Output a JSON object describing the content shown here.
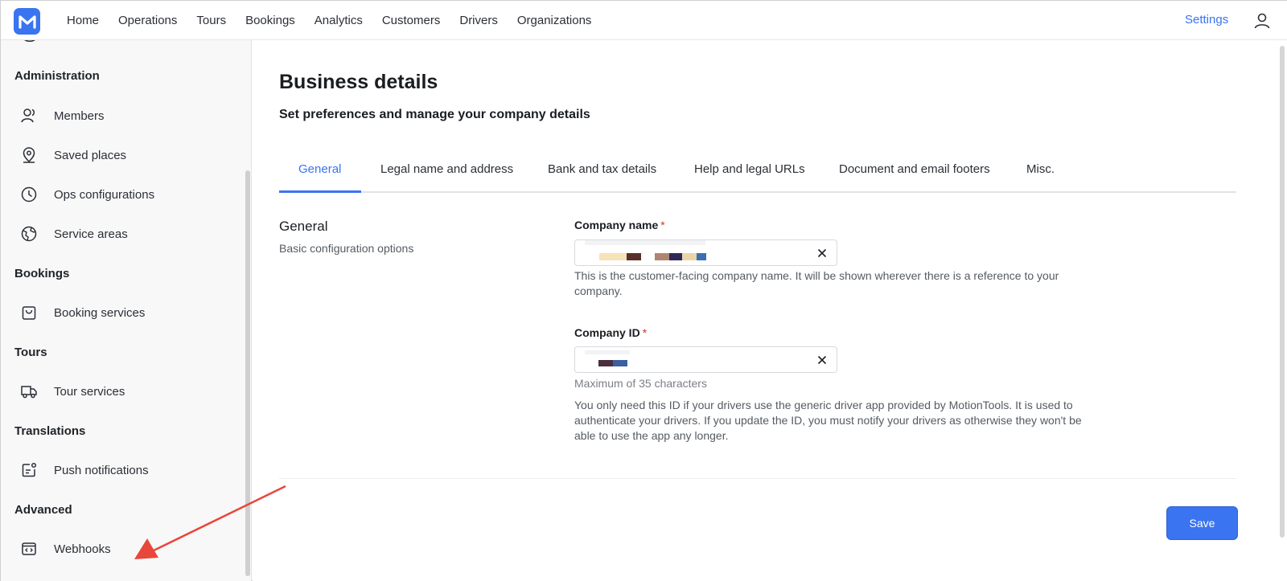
{
  "brand": {
    "logo_letter": "M",
    "accent": "#3a74f0"
  },
  "topnav": {
    "items": [
      "Home",
      "Operations",
      "Tours",
      "Bookings",
      "Analytics",
      "Customers",
      "Drivers",
      "Organizations"
    ],
    "settings_label": "Settings"
  },
  "sidebar": {
    "sections": [
      {
        "title": "Administration",
        "items": [
          "Members",
          "Saved places",
          "Ops configurations",
          "Service areas"
        ]
      },
      {
        "title": "Bookings",
        "items": [
          "Booking services"
        ]
      },
      {
        "title": "Tours",
        "items": [
          "Tour services"
        ]
      },
      {
        "title": "Translations",
        "items": [
          "Push notifications"
        ]
      },
      {
        "title": "Advanced",
        "items": [
          "Webhooks"
        ]
      }
    ]
  },
  "page": {
    "title": "Business details",
    "subtitle": "Set preferences and manage your company details",
    "tabs": [
      "General",
      "Legal name and address",
      "Bank and tax details",
      "Help and legal URLs",
      "Document and email footers",
      "Misc."
    ],
    "active_tab": "General"
  },
  "general": {
    "title": "General",
    "description": "Basic configuration options",
    "company_name": {
      "label": "Company name",
      "required_mark": "*",
      "help": "This is the customer-facing company name. It will be shown wherever there is a reference to your company."
    },
    "company_id": {
      "label": "Company ID",
      "required_mark": "*",
      "hint": "Maximum of 35 characters",
      "help": "You only need this ID if your drivers use the generic driver app provided by MotionTools. It is used to authenticate your drivers. If you update the ID, you must notify your drivers as otherwise they won't be able to use the app any longer."
    }
  },
  "actions": {
    "save_label": "Save"
  },
  "annotation": {
    "arrow_color": "#e8473b"
  }
}
